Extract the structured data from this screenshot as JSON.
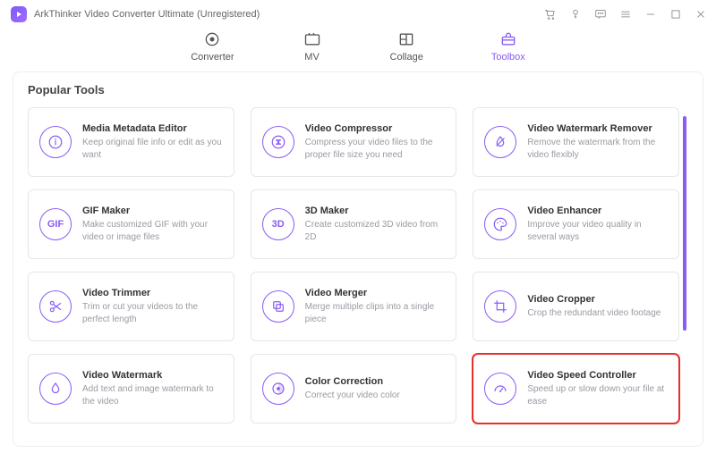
{
  "app": {
    "title": "ArkThinker Video Converter Ultimate (Unregistered)"
  },
  "nav": {
    "items": [
      {
        "label": "Converter"
      },
      {
        "label": "MV"
      },
      {
        "label": "Collage"
      },
      {
        "label": "Toolbox"
      }
    ]
  },
  "section": {
    "title": "Popular Tools"
  },
  "tools": [
    {
      "title": "Media Metadata Editor",
      "desc": "Keep original file info or edit as you want",
      "icon": "info"
    },
    {
      "title": "Video Compressor",
      "desc": "Compress your video files to the proper file size you need",
      "icon": "compress"
    },
    {
      "title": "Video Watermark Remover",
      "desc": "Remove the watermark from the video flexibly",
      "icon": "drop-off"
    },
    {
      "title": "GIF Maker",
      "desc": "Make customized GIF with your video or image files",
      "icon": "gif"
    },
    {
      "title": "3D Maker",
      "desc": "Create customized 3D video from 2D",
      "icon": "3d"
    },
    {
      "title": "Video Enhancer",
      "desc": "Improve your video quality in several ways",
      "icon": "palette"
    },
    {
      "title": "Video Trimmer",
      "desc": "Trim or cut your videos to the perfect length",
      "icon": "scissors"
    },
    {
      "title": "Video Merger",
      "desc": "Merge multiple clips into a single piece",
      "icon": "merge"
    },
    {
      "title": "Video Cropper",
      "desc": "Crop the redundant video footage",
      "icon": "crop"
    },
    {
      "title": "Video Watermark",
      "desc": "Add text and image watermark to the video",
      "icon": "drop"
    },
    {
      "title": "Color Correction",
      "desc": "Correct your video color",
      "icon": "color"
    },
    {
      "title": "Video Speed Controller",
      "desc": "Speed up or slow down your file at ease",
      "icon": "gauge",
      "highlight": true
    }
  ]
}
